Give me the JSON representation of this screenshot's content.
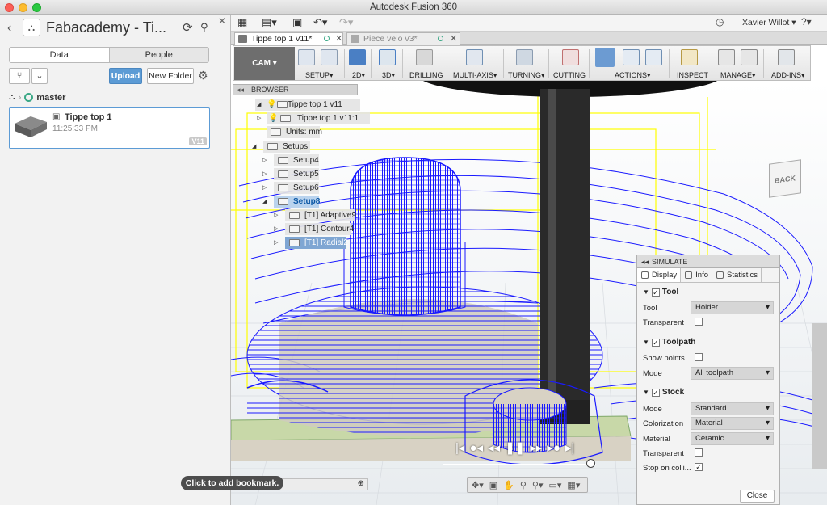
{
  "window": {
    "title": "Autodesk Fusion 360"
  },
  "data_panel": {
    "title": "Fabacademy - Ti...",
    "tabs": [
      "Data",
      "People"
    ],
    "upload_label": "Upload",
    "new_folder_label": "New Folder",
    "branch": "master",
    "file": {
      "name": "Tippe top 1",
      "time": "11:25:33 PM",
      "version": "V11"
    },
    "bookmark_hint": "Click to add bookmark."
  },
  "quickbar": {
    "user": "Xavier Willot"
  },
  "doc_tabs": [
    {
      "label": "Tippe top 1 v11*",
      "active": true
    },
    {
      "label": "Piece velo v3*",
      "active": false
    }
  ],
  "ribbon": {
    "workspace": "CAM",
    "groups": [
      "SETUP",
      "2D",
      "3D",
      "DRILLING",
      "MULTI-AXIS",
      "TURNING",
      "CUTTING",
      "ACTIONS",
      "INSPECT",
      "MANAGE",
      "ADD-INS"
    ]
  },
  "viewcube": {
    "face": "BACK"
  },
  "browser": {
    "title": "BROWSER",
    "root": "Tippe top 1 v11",
    "component": "Tippe top 1 v11:1",
    "units": "Units: mm",
    "setups_folder": "Setups",
    "setups": [
      "Setup4",
      "Setup5",
      "Setup6",
      "Setup8"
    ],
    "operations": [
      "[T1] Adaptive9",
      "[T1] Contour4",
      "[T1] Radial2"
    ]
  },
  "simulate": {
    "title": "SIMULATE",
    "tabs": [
      "Display",
      "Info",
      "Statistics"
    ],
    "tool_section": "Tool",
    "tool_label": "Tool",
    "tool_value": "Holder",
    "tool_transparent_label": "Transparent",
    "toolpath_section": "Toolpath",
    "show_points_label": "Show points",
    "toolpath_mode_label": "Mode",
    "toolpath_mode_value": "All toolpath",
    "stock_section": "Stock",
    "stock_mode_label": "Mode",
    "stock_mode_value": "Standard",
    "colorization_label": "Colorization",
    "colorization_value": "Material",
    "material_label": "Material",
    "material_value": "Ceramic",
    "stock_transparent_label": "Transparent",
    "stop_on_collision_label": "Stop on colli...",
    "close_label": "Close"
  },
  "colors": {
    "accent": "#5c9bd5",
    "toolpath": "#1a1aff",
    "stock_boundary": "#ffff00",
    "stock_top": "#c8d8a8"
  }
}
